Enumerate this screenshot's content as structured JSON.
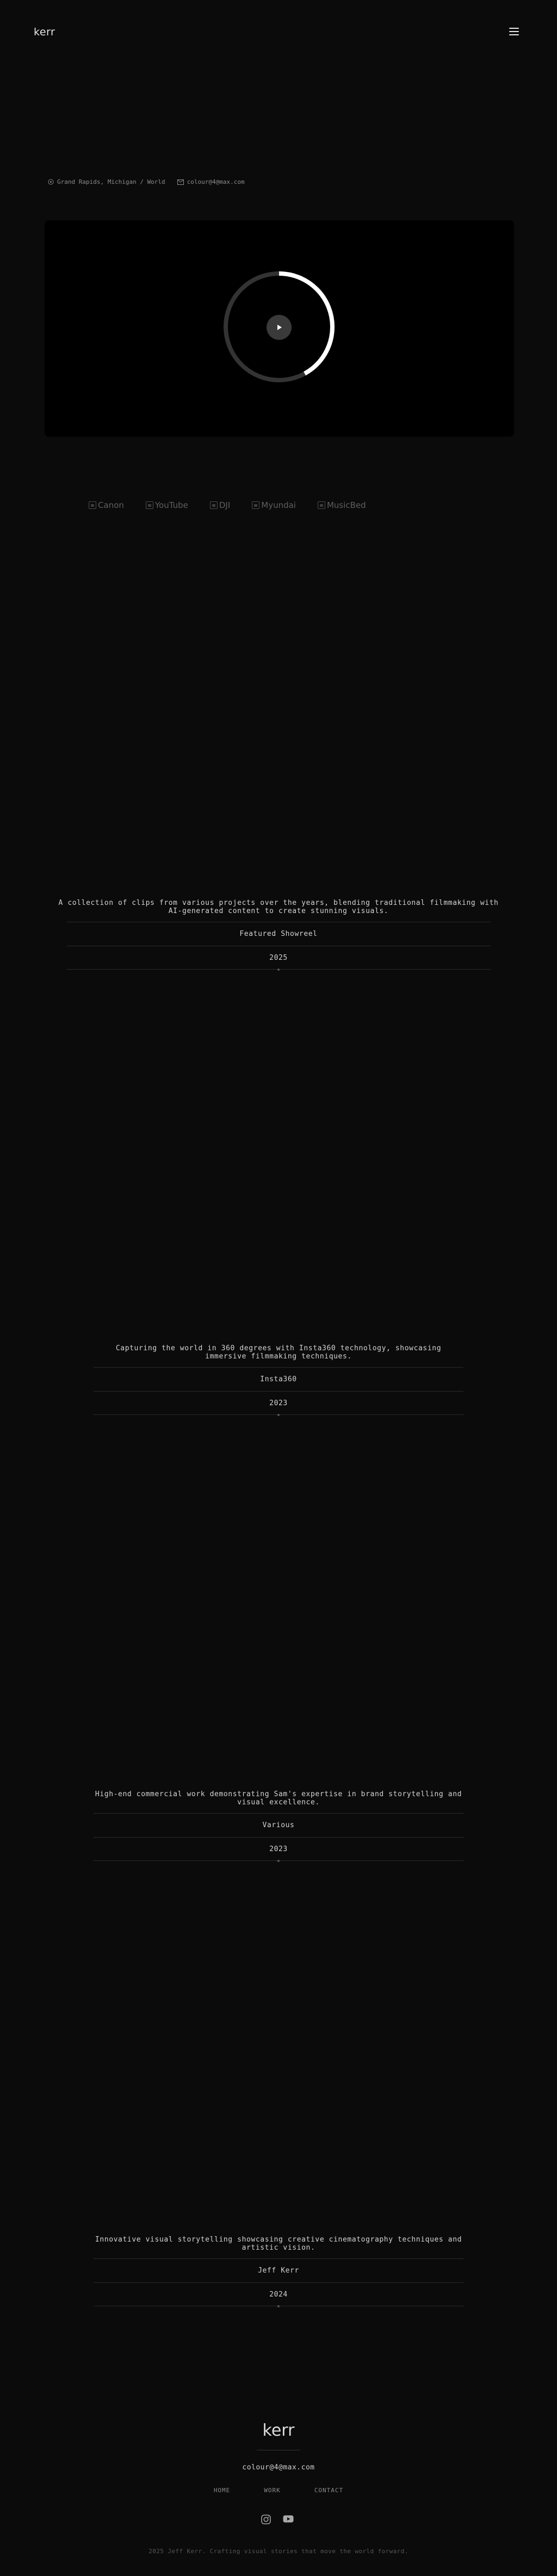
{
  "header": {
    "logo": "kerr",
    "menu_icon": "hamburger-menu-icon"
  },
  "contact": {
    "location": "Grand Rapids, Michigan / World",
    "location_icon": "map-pin-icon",
    "email": "colour@4@max.com",
    "email_icon": "mail-icon"
  },
  "video": {
    "play_icon": "play-icon",
    "progress": 0.42
  },
  "clients": [
    "Canon",
    "YouTube",
    "DJI",
    "Myundai",
    "MusicBed"
  ],
  "projects": [
    {
      "description": "A collection of clips from various projects over the years, blending traditional filmmaking with AI-generated content to create stunning visuals.",
      "client": "Featured Showreel",
      "year": "2025"
    },
    {
      "description": "Capturing the world in 360 degrees with Insta360 technology, showcasing immersive filmmaking techniques.",
      "client": "Insta360",
      "year": "2023"
    },
    {
      "description": "High-end commercial work demonstrating Sam's expertise in brand storytelling and visual excellence.",
      "client": "Various",
      "year": "2023"
    },
    {
      "description": "Innovative visual storytelling showcasing creative cinematography techniques and artistic vision.",
      "client": "Jeff Kerr",
      "year": "2024"
    }
  ],
  "footer": {
    "logo": "kerr",
    "email": "colour@4@max.com",
    "nav": [
      "HOME",
      "WORK",
      "CONTACT"
    ],
    "social": [
      "instagram-icon",
      "youtube-icon"
    ],
    "copyright": "2025 Jeff Kerr. Crafting visual stories that move the world forward."
  },
  "colors": {
    "background": "#0b0b0b",
    "text": "#d4d4d4",
    "muted": "#8c8c8c",
    "ring_track": "#333333",
    "ring_progress": "#ffffff"
  }
}
